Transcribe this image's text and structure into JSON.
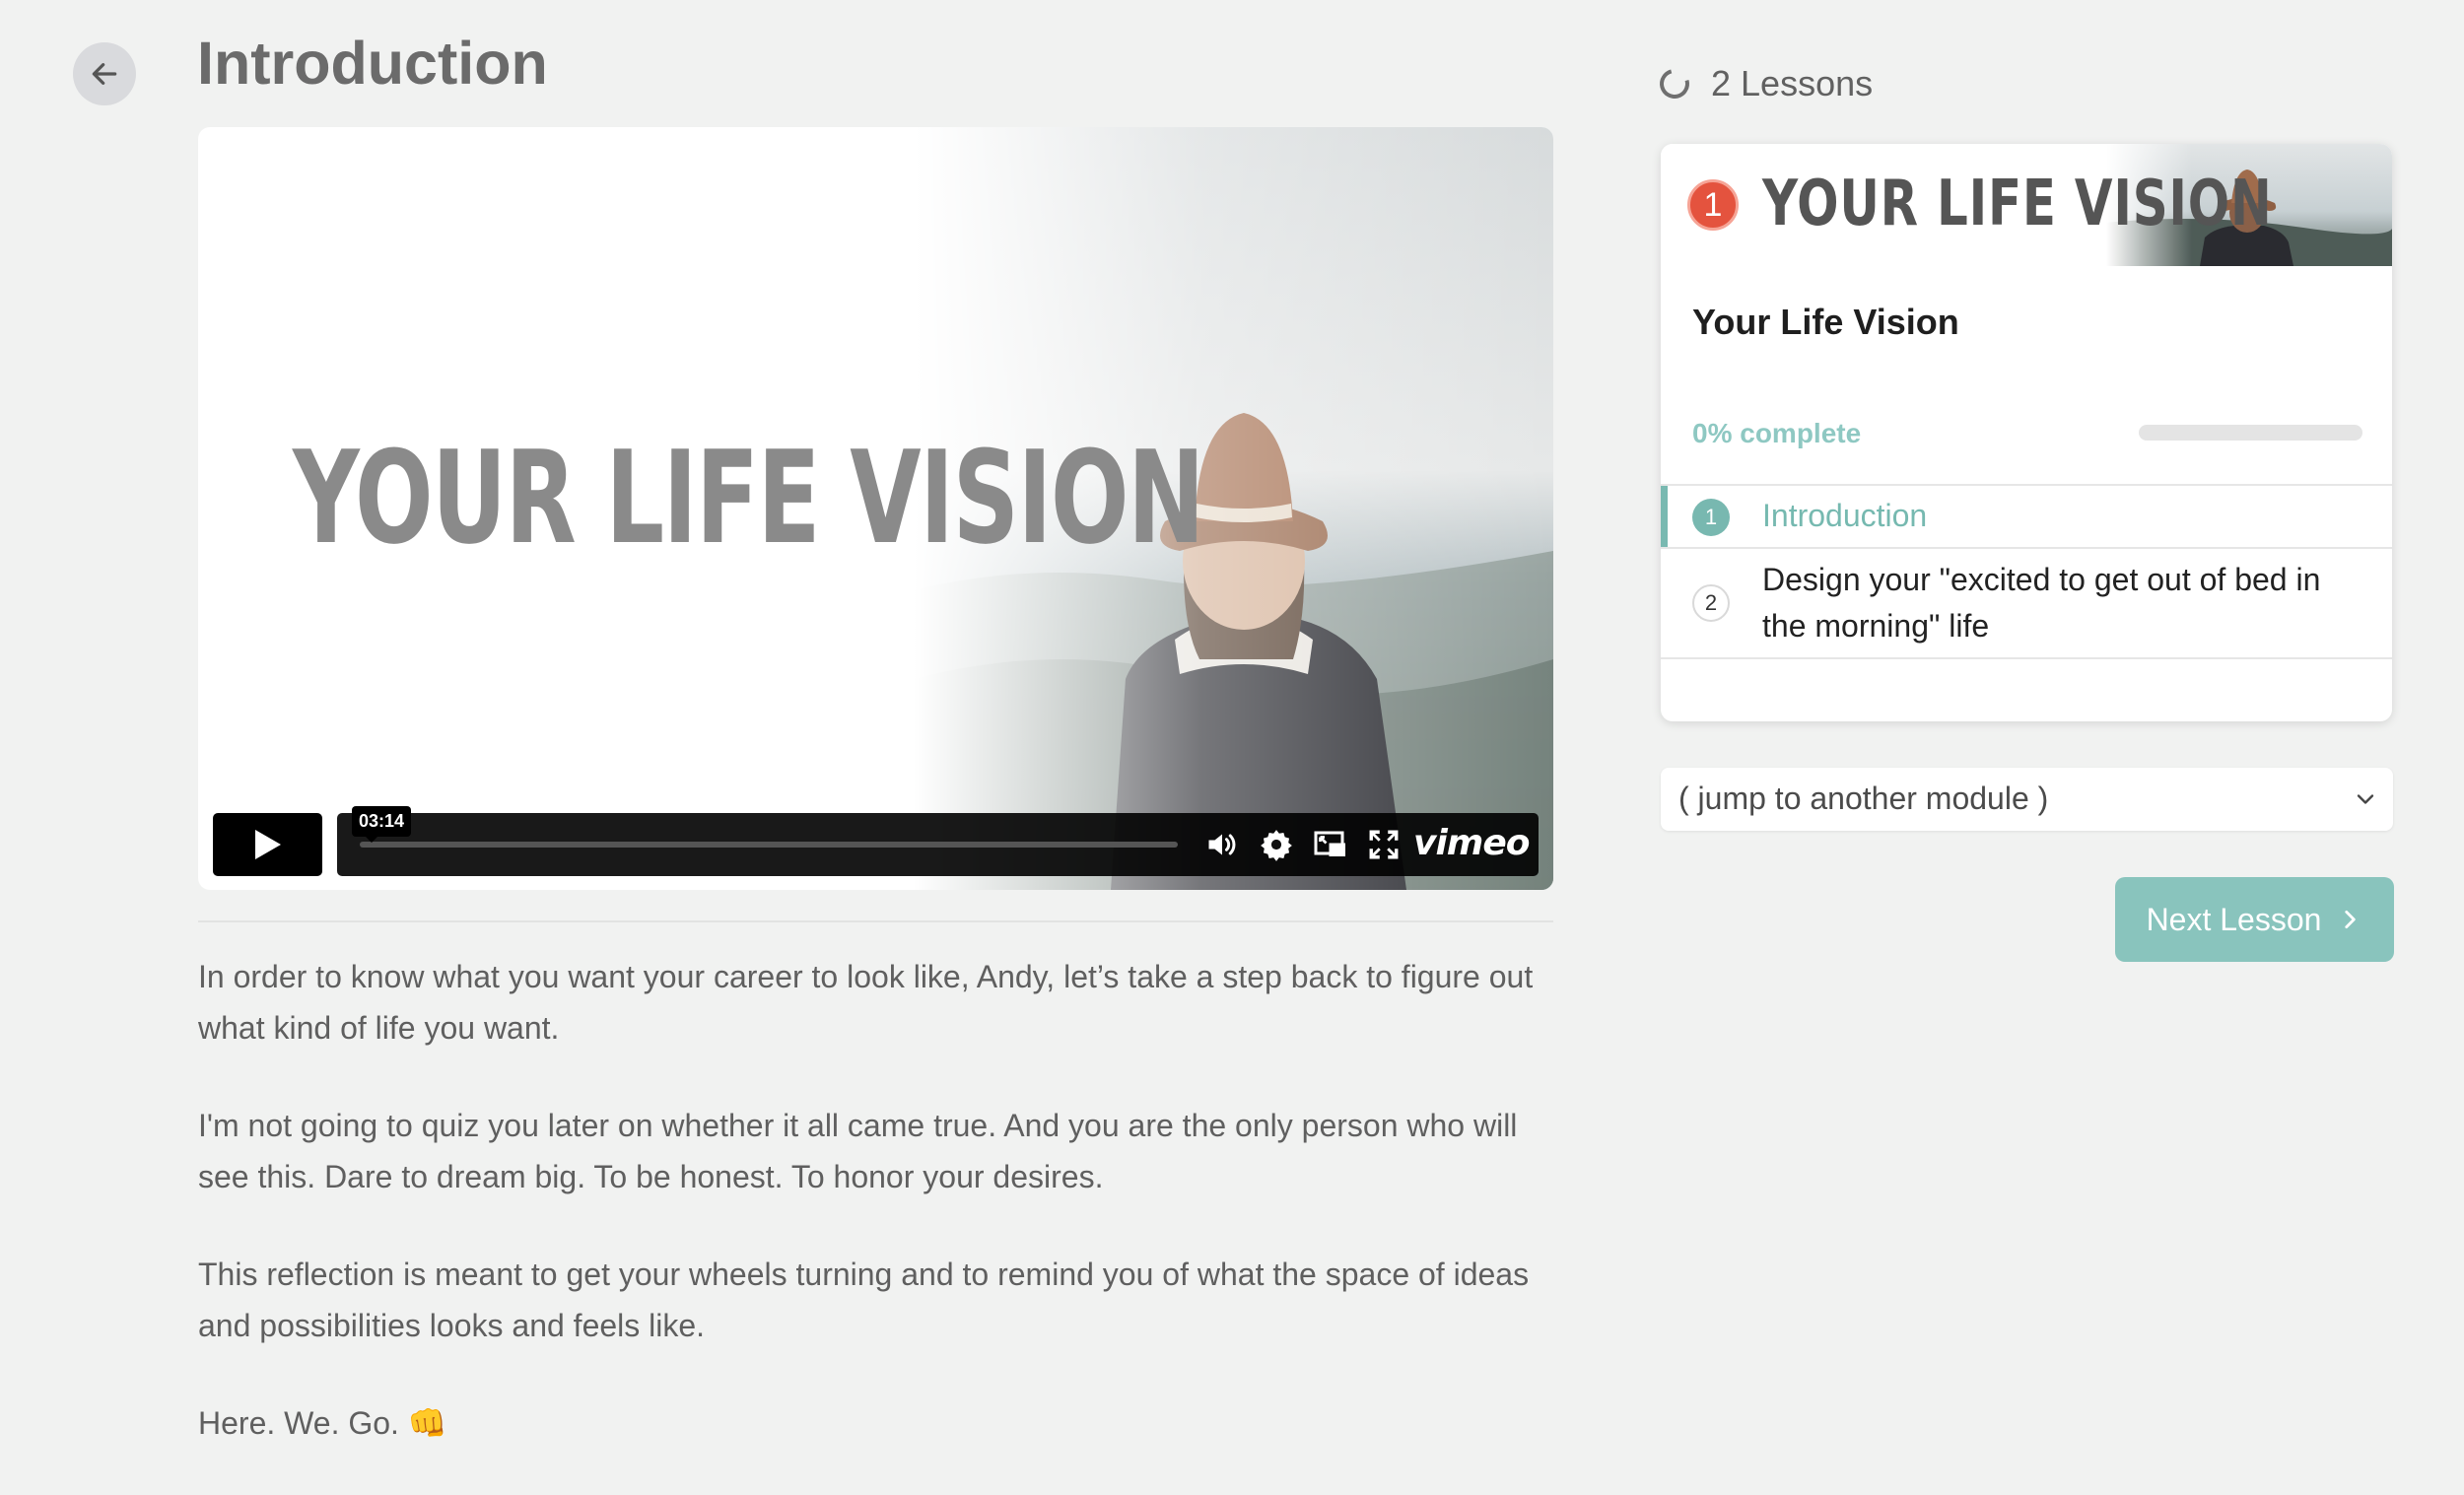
{
  "page": {
    "title": "Introduction"
  },
  "video": {
    "overlay_title": "YOUR LIFE VISION",
    "time_display": "03:14",
    "progress_fraction": 0,
    "brand_label": "vimeo"
  },
  "body": {
    "paragraphs": [
      "In order to know what you want your career to look like, Andy,  let’s take a step back to figure out what kind of life you want.",
      "I'm not going to quiz you later on whether it all came true. And you are the only person who will see this. Dare to dream big. To be honest. To honor your desires.",
      "This reflection is meant to get your wheels turning and to remind you of what the space of ideas and possibilities looks and feels like.",
      "Here. We. Go. 👊"
    ]
  },
  "sidebar": {
    "lessons_count": "2 Lessons",
    "module": {
      "banner_number": "1",
      "banner_title": "YOUR LIFE VISION",
      "title": "Your Life Vision",
      "complete_label": "0% complete",
      "complete_fraction": 0
    },
    "lessons": [
      {
        "number": "1",
        "label": "Introduction"
      },
      {
        "number": "2",
        "label": "Design your \"excited to get out of bed in the morning\" life"
      }
    ],
    "module_select": "( jump to another module )",
    "next_button": "Next Lesson"
  },
  "colors": {
    "accent": "#79b9b1",
    "button": "#89c4bd",
    "badge_red": "#e4533e"
  },
  "icons": {
    "back": "arrow-left-icon",
    "play": "play-icon",
    "volume": "volume-icon",
    "settings": "gear-icon",
    "pip": "picture-in-picture-icon",
    "fullscreen": "fullscreen-icon",
    "lessons": "progress-ring-icon",
    "select": "chevron-down-icon",
    "next": "chevron-right-icon"
  }
}
